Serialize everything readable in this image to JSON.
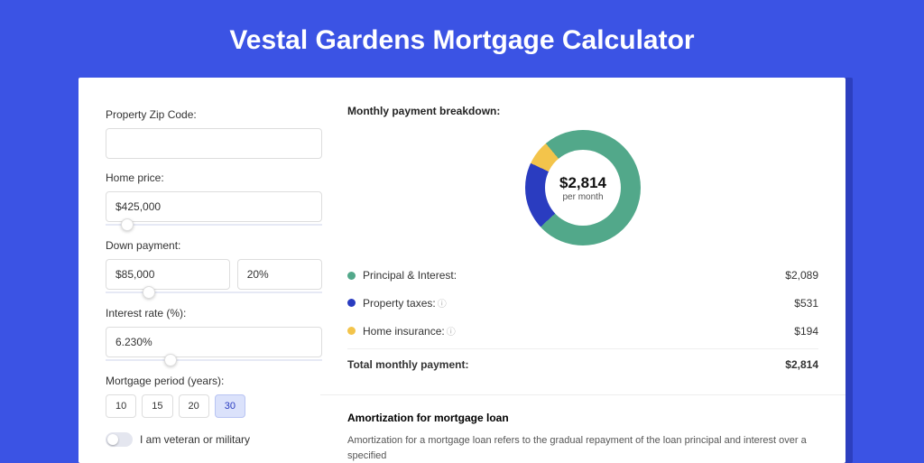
{
  "page_title": "Vestal Gardens Mortgage Calculator",
  "form": {
    "zip_label": "Property Zip Code:",
    "zip_value": "",
    "home_price_label": "Home price:",
    "home_price_value": "$425,000",
    "home_price_slider_pct": 10,
    "down_payment_label": "Down payment:",
    "down_payment_value": "$85,000",
    "down_payment_pct": "20%",
    "down_payment_slider_pct": 20,
    "interest_label": "Interest rate (%):",
    "interest_value": "6.230%",
    "interest_slider_pct": 30,
    "period_label": "Mortgage period (years):",
    "periods": [
      "10",
      "15",
      "20",
      "30"
    ],
    "period_selected": "30",
    "veteran_label": "I am veteran or military"
  },
  "breakdown": {
    "title": "Monthly payment breakdown:",
    "center_amount": "$2,814",
    "center_sub": "per month",
    "items": [
      {
        "label": "Principal & Interest:",
        "value": "$2,089",
        "color": "#52a88a",
        "info": false
      },
      {
        "label": "Property taxes:",
        "value": "$531",
        "color": "#2a3cc0",
        "info": true
      },
      {
        "label": "Home insurance:",
        "value": "$194",
        "color": "#f3c44b",
        "info": true
      }
    ],
    "total_label": "Total monthly payment:",
    "total_value": "$2,814"
  },
  "amortization": {
    "title": "Amortization for mortgage loan",
    "text": "Amortization for a mortgage loan refers to the gradual repayment of the loan principal and interest over a specified"
  },
  "chart_data": {
    "type": "pie",
    "title": "Monthly payment breakdown",
    "series": [
      {
        "name": "Principal & Interest",
        "value": 2089,
        "color": "#52a88a"
      },
      {
        "name": "Property taxes",
        "value": 531,
        "color": "#2a3cc0"
      },
      {
        "name": "Home insurance",
        "value": 194,
        "color": "#f3c44b"
      }
    ],
    "total": 2814
  }
}
